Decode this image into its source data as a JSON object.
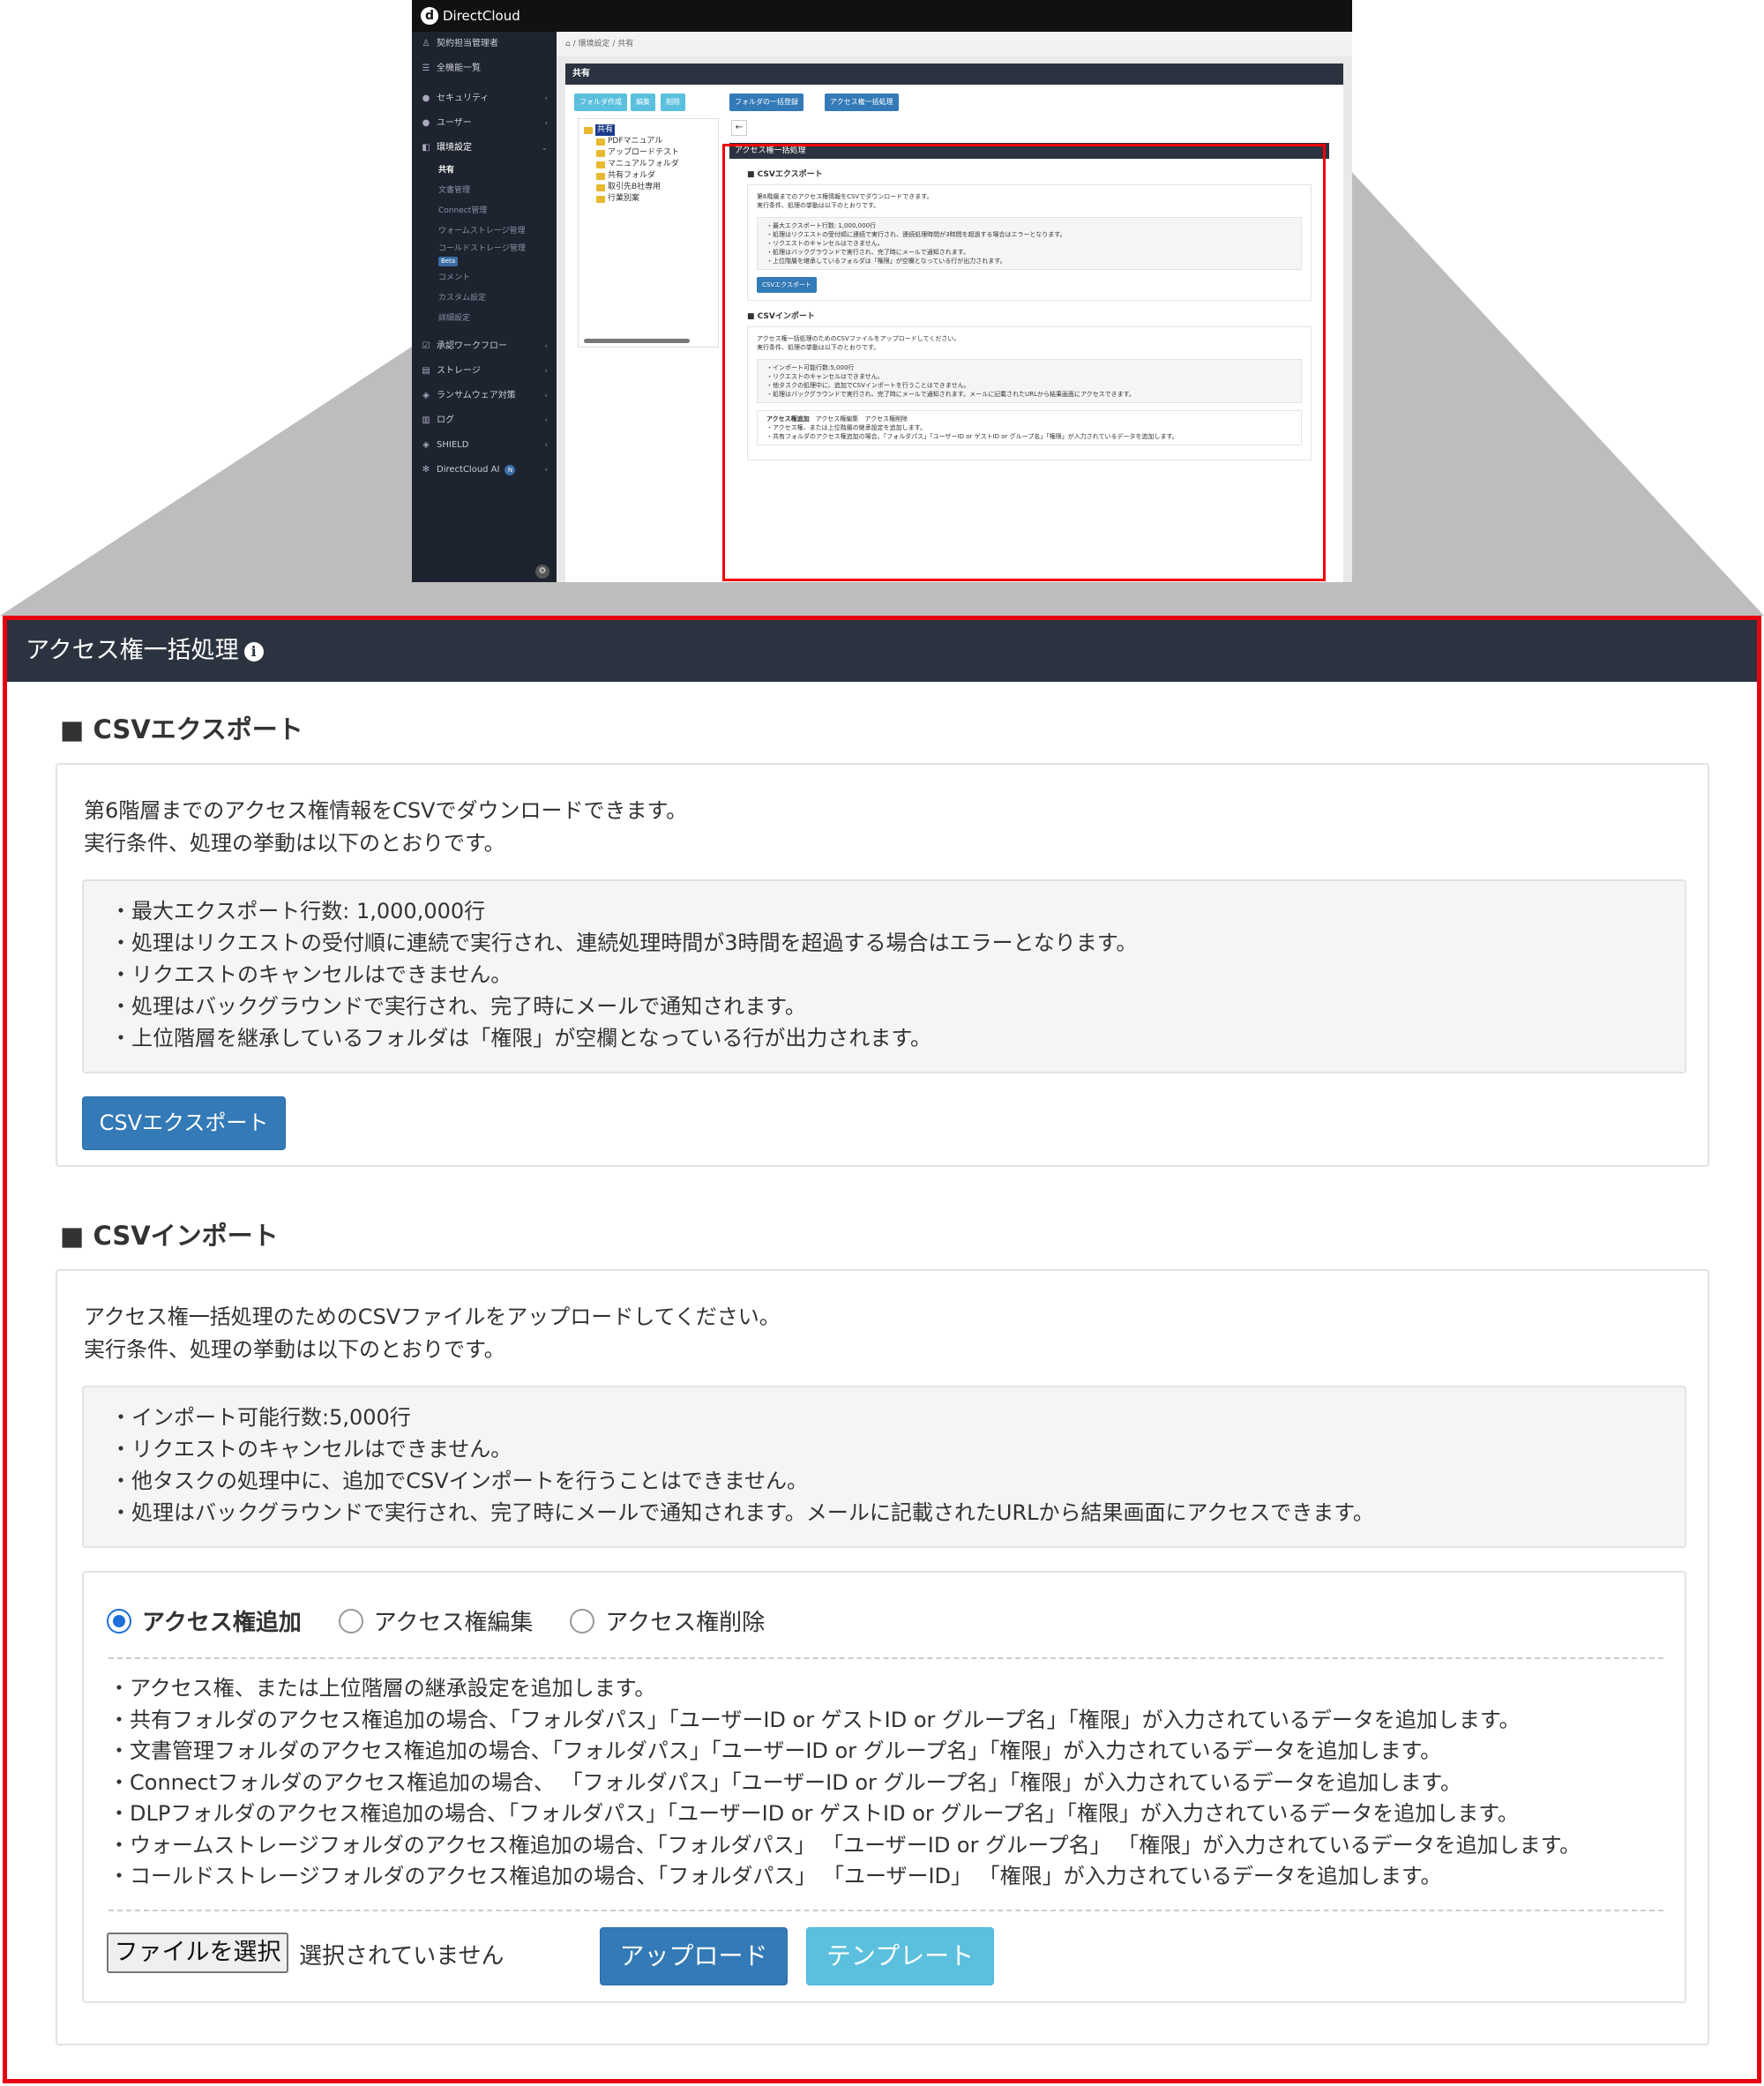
{
  "thumbnail": {
    "brand": "DirectCloud",
    "breadcrumb": "環境設定 / 共有",
    "sidebar": {
      "top_items": [
        {
          "label": "契約担当管理者",
          "icon": "user-icon"
        },
        {
          "label": "全機能一覧",
          "icon": "list-icon"
        }
      ],
      "items": [
        {
          "label": "セキュリティ",
          "icon": "lock-icon"
        },
        {
          "label": "ユーザー",
          "icon": "user-circle-icon"
        },
        {
          "label": "環境設定",
          "icon": "settings-icon"
        }
      ],
      "sub_items": [
        "共有",
        "文書管理",
        "Connect管理",
        "ウォームストレージ管理",
        "コールドストレージ管理",
        "コメント",
        "カスタム設定",
        "詳細設定"
      ],
      "beta": "Beta",
      "lower_items": [
        {
          "label": "承認ワークフロー",
          "icon": "check-icon"
        },
        {
          "label": "ストレージ",
          "icon": "database-icon"
        },
        {
          "label": "ランサムウェア対策",
          "icon": "shield-icon"
        },
        {
          "label": "ログ",
          "icon": "chart-icon"
        },
        {
          "label": "SHIELD",
          "icon": "shield-icon"
        },
        {
          "label": "DirectCloud AI",
          "icon": "ai-icon",
          "badge": "N"
        }
      ]
    },
    "panel_title": "共有",
    "toolbar": {
      "create_folder": "フォルダ作成",
      "edit": "編集",
      "delete": "削除",
      "bulk_folder": "フォルダの一括登録",
      "bulk_access": "アクセス権一括処理"
    },
    "tree": [
      "共有",
      "PDFマニュアル",
      "アップロードテスト",
      "マニュアルフォルダ",
      "共有フォルダ",
      "取引先B社専用",
      "行業別案"
    ],
    "mini": {
      "title": "アクセス権一括処理",
      "export_title": "■ CSVエクスポート",
      "import_title": "■ CSVインポート"
    }
  },
  "panel": {
    "title": "アクセス権一括処理",
    "info_icon": "i"
  },
  "export": {
    "section_title": "■ CSVエクスポート",
    "description": [
      "第6階層までのアクセス権情報をCSVでダウンロードできます。",
      "実行条件、処理の挙動は以下のとおりです。"
    ],
    "conditions": [
      "・最大エクスポート行数: 1,000,000行",
      "・処理はリクエストの受付順に連続で実行され、連続処理時間が3時間を超過する場合はエラーとなります。",
      "・リクエストのキャンセルはできません。",
      "・処理はバックグラウンドで実行され、完了時にメールで通知されます。",
      "・上位階層を継承しているフォルダは「権限」が空欄となっている行が出力されます。"
    ],
    "button_label": "CSVエクスポート"
  },
  "import": {
    "section_title": "■ CSVインポート",
    "description": [
      "アクセス権一括処理のためのCSVファイルをアップロードしてください。",
      "実行条件、処理の挙動は以下のとおりです。"
    ],
    "conditions": [
      "・インポート可能行数:5,000行",
      "・リクエストのキャンセルはできません。",
      "・他タスクの処理中に、追加でCSVインポートを行うことはできません。",
      "・処理はバックグラウンドで実行され、完了時にメールで通知されます。メールに記載されたURLから結果画面にアクセスできます。"
    ],
    "modes": [
      {
        "label": "アクセス権追加",
        "selected": true
      },
      {
        "label": "アクセス権編集",
        "selected": false
      },
      {
        "label": "アクセス権削除",
        "selected": false
      }
    ],
    "mode_rules": [
      "・アクセス権、または上位階層の継承設定を追加します。",
      "・共有フォルダのアクセス権追加の場合、「フォルダパス」「ユーザーID or ゲストID or グループ名」「権限」が入力されているデータを追加します。",
      "・文書管理フォルダのアクセス権追加の場合、「フォルダパス」「ユーザーID or グループ名」「権限」が入力されているデータを追加します。",
      "・Connectフォルダのアクセス権追加の場合、 「フォルダパス」「ユーザーID or グループ名」「権限」が入力されているデータを追加します。",
      "・DLPフォルダのアクセス権追加の場合、「フォルダパス」「ユーザーID or ゲストID or グループ名」「権限」が入力されているデータを追加します。",
      "・ウォームストレージフォルダのアクセス権追加の場合、「フォルダパス」 「ユーザーID or グループ名」 「権限」が入力されているデータを追加します。",
      "・コールドストレージフォルダのアクセス権追加の場合、「フォルダパス」 「ユーザーID」 「権限」が入力されているデータを追加します。"
    ],
    "file_button": "ファイルを選択",
    "file_status": "選択されていません",
    "upload_button": "アップロード",
    "template_button": "テンプレート"
  },
  "colors": {
    "header_bg": "#2c3340",
    "highlight_border": "#e60012",
    "primary": "#337ab7",
    "info": "#5bc0de",
    "radio_selected": "#1e6fd9"
  }
}
